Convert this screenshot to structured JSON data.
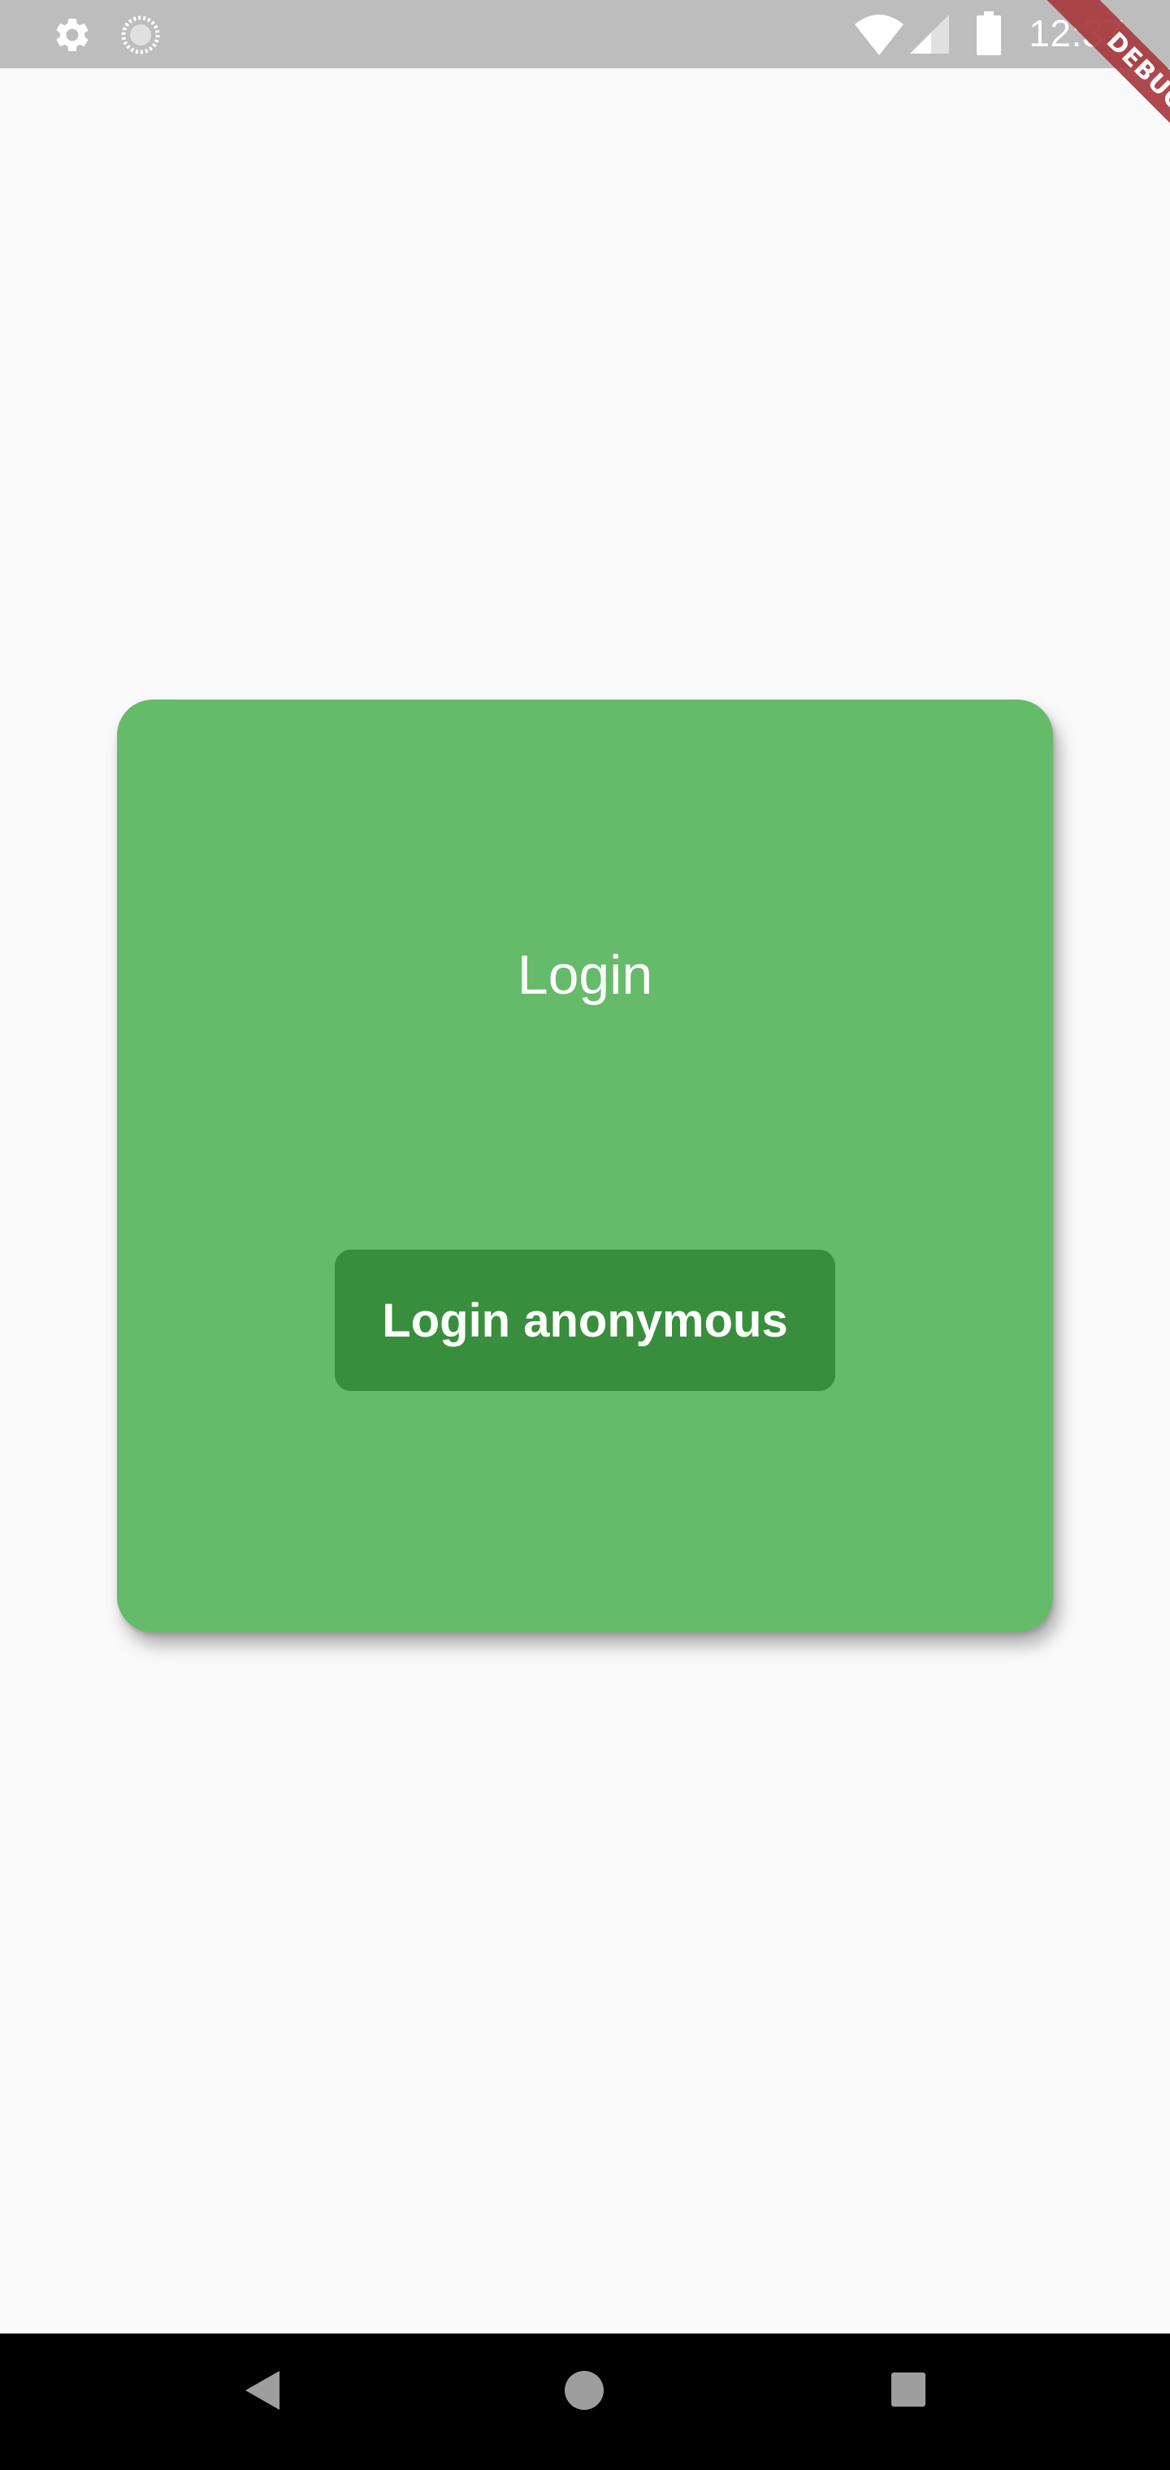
{
  "status_bar": {
    "time": "12:37",
    "icons": [
      "gear-icon",
      "loading-icon",
      "wifi-icon",
      "cell-signal-icon",
      "battery-icon"
    ]
  },
  "debug_banner": {
    "label": "DEBUG",
    "color": "#a83a3f"
  },
  "login_card": {
    "title": "Login",
    "button_label": "Login anonymous",
    "card_color": "#66bb6a",
    "button_color": "#388e3c"
  },
  "nav_bar": {
    "buttons": [
      "back-icon",
      "home-icon",
      "recents-icon"
    ]
  },
  "colors": {
    "status_bar": "#bdbdbd",
    "background": "#fafafa",
    "nav_bar": "#000000"
  }
}
